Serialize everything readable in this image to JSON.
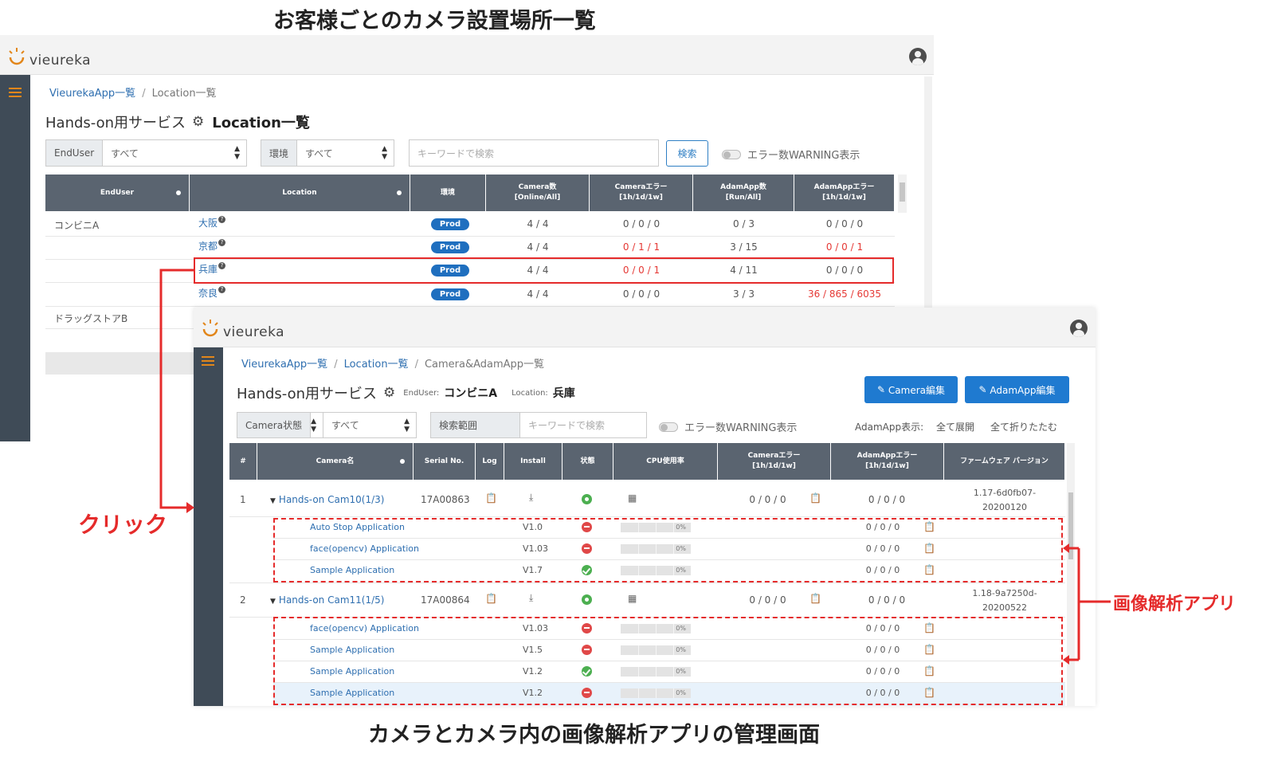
{
  "captions": {
    "top": "お客様ごとのカメラ設置場所一覧",
    "bottom": "カメラとカメラ内の画像解析アプリの管理画面"
  },
  "annotations": {
    "click": "クリック",
    "apps": "画像解析アプリ",
    "color": "#e52b2b"
  },
  "brand": {
    "name": "vieureka",
    "accent": "#e2861a",
    "sidebar": "#3f4b57"
  },
  "location_window": {
    "breadcrumb": [
      "VieurekaApp一覧",
      "Location一覧"
    ],
    "service_title": "Hands-on用サービス",
    "page_title": "Location一覧",
    "filters": {
      "enduser_label": "EndUser",
      "enduser_value": "すべて",
      "env_label": "環境",
      "env_value": "すべて",
      "search_placeholder": "キーワードで検索",
      "search_button": "検索",
      "warning_toggle": "エラー数WARNING表示"
    },
    "columns": [
      "EndUser",
      "Location",
      "環境",
      "Camera数\n[Online/All]",
      "Cameraエラー\n[1h/1d/1w]",
      "AdamApp数\n[Run/All]",
      "AdamAppエラー\n[1h/1d/1w]"
    ],
    "rows": [
      {
        "enduser": "コンビニA",
        "location": "大阪",
        "env": "Prod",
        "camera": "4 / 4",
        "camera_err": "0 / 0 / 0",
        "adam": "0 / 3",
        "adam_err": "0 / 0 / 0"
      },
      {
        "enduser": "",
        "location": "京都",
        "env": "Prod",
        "camera": "4 / 4",
        "camera_err": "0 / 1 / 1",
        "adam": "3 / 15",
        "adam_err": "0 / 0 / 1"
      },
      {
        "enduser": "",
        "location": "兵庫",
        "env": "Prod",
        "camera": "4 / 4",
        "camera_err": "0 / 0 / 1",
        "adam": "4 / 11",
        "adam_err": "0 / 0 / 0"
      },
      {
        "enduser": "",
        "location": "奈良",
        "env": "Prod",
        "camera": "4 / 4",
        "camera_err": "0 / 0 / 0",
        "adam": "3 / 3",
        "adam_err": "36 / 865 / 6035"
      },
      {
        "enduser": "ドラッグストアB"
      }
    ]
  },
  "camera_window": {
    "breadcrumb": [
      "VieurekaApp一覧",
      "Location一覧",
      "Camera&AdamApp一覧"
    ],
    "service_title": "Hands-on用サービス",
    "enduser_label": "EndUser:",
    "enduser_value": "コンビニA",
    "location_label": "Location:",
    "location_value": "兵庫",
    "buttons": {
      "camera_edit": "Camera編集",
      "adam_edit": "AdamApp編集"
    },
    "filters": {
      "state_label": "Camera状態",
      "state_value": "すべて",
      "range_label": "検索範囲",
      "search_placeholder": "キーワードで検索",
      "warning_toggle": "エラー数WARNING表示",
      "adam_display": "AdamApp表示:",
      "expand_all": "全て展開",
      "collapse_all": "全て折りたたむ"
    },
    "columns": [
      "#",
      "Camera名",
      "Serial No.",
      "Log",
      "Install",
      "状態",
      "CPU使用率",
      "Cameraエラー\n[1h/1d/1w]",
      "AdamAppエラー\n[1h/1d/1w]",
      "ファームウェア バージョン"
    ],
    "cameras": [
      {
        "no": "1",
        "name": "Hands-on Cam10(1/3)",
        "serial": "17A00863",
        "camera_err": "0 / 0 / 0",
        "adam_err": "0 / 0 / 0",
        "firmware": "1.17-6d0fb07-\n20200120",
        "apps": [
          {
            "name": "Auto Stop Application",
            "version": "V1.0",
            "state": "ng",
            "cpu": "0%",
            "err": "0 / 0 / 0"
          },
          {
            "name": "face(opencv) Application",
            "version": "V1.03",
            "state": "ng",
            "cpu": "0%",
            "err": "0 / 0 / 0"
          },
          {
            "name": "Sample Application",
            "version": "V1.7",
            "state": "ok",
            "cpu": "0%",
            "err": "0 / 0 / 0"
          }
        ]
      },
      {
        "no": "2",
        "name": "Hands-on Cam11(1/5)",
        "serial": "17A00864",
        "camera_err": "0 / 0 / 0",
        "adam_err": "0 / 0 / 0",
        "firmware": "1.18-9a7250d-\n20200522",
        "apps": [
          {
            "name": "face(opencv) Application",
            "version": "V1.03",
            "state": "ng",
            "cpu": "0%",
            "err": "0 / 0 / 0"
          },
          {
            "name": "Sample Application",
            "version": "V1.5",
            "state": "ng",
            "cpu": "0%",
            "err": "0 / 0 / 0"
          },
          {
            "name": "Sample Application",
            "version": "V1.2",
            "state": "ok",
            "cpu": "0%",
            "err": "0 / 0 / 0"
          },
          {
            "name": "Sample Application",
            "version": "V1.2",
            "state": "ng",
            "cpu": "0%",
            "err": "0 / 0 / 0"
          }
        ]
      }
    ]
  }
}
